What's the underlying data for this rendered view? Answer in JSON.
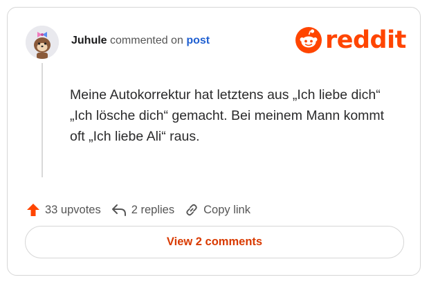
{
  "comment": {
    "author": "Juhule",
    "action_text": "commented on",
    "target_link": "post",
    "body": "Meine Autokorrektur hat letztens aus „Ich liebe dich“ „Ich lösche dich“ gemacht. Bei meinem Mann kommt oft „Ich liebe Ali“ raus."
  },
  "brand": {
    "wordmark": "reddit",
    "color": "#ff4500"
  },
  "actions": {
    "upvotes": "33 upvotes",
    "replies": "2 replies",
    "copy_link": "Copy link"
  },
  "view_comments_label": "View 2 comments",
  "icons": {
    "avatar": "avatar-icon",
    "logo": "reddit-snoo-icon",
    "upvote": "upvote-arrow-icon",
    "reply": "reply-icon",
    "link": "link-icon"
  },
  "colors": {
    "upvote_active": "#ff4500",
    "link_blue": "#1f5fd1",
    "button_text": "#d93a00"
  }
}
